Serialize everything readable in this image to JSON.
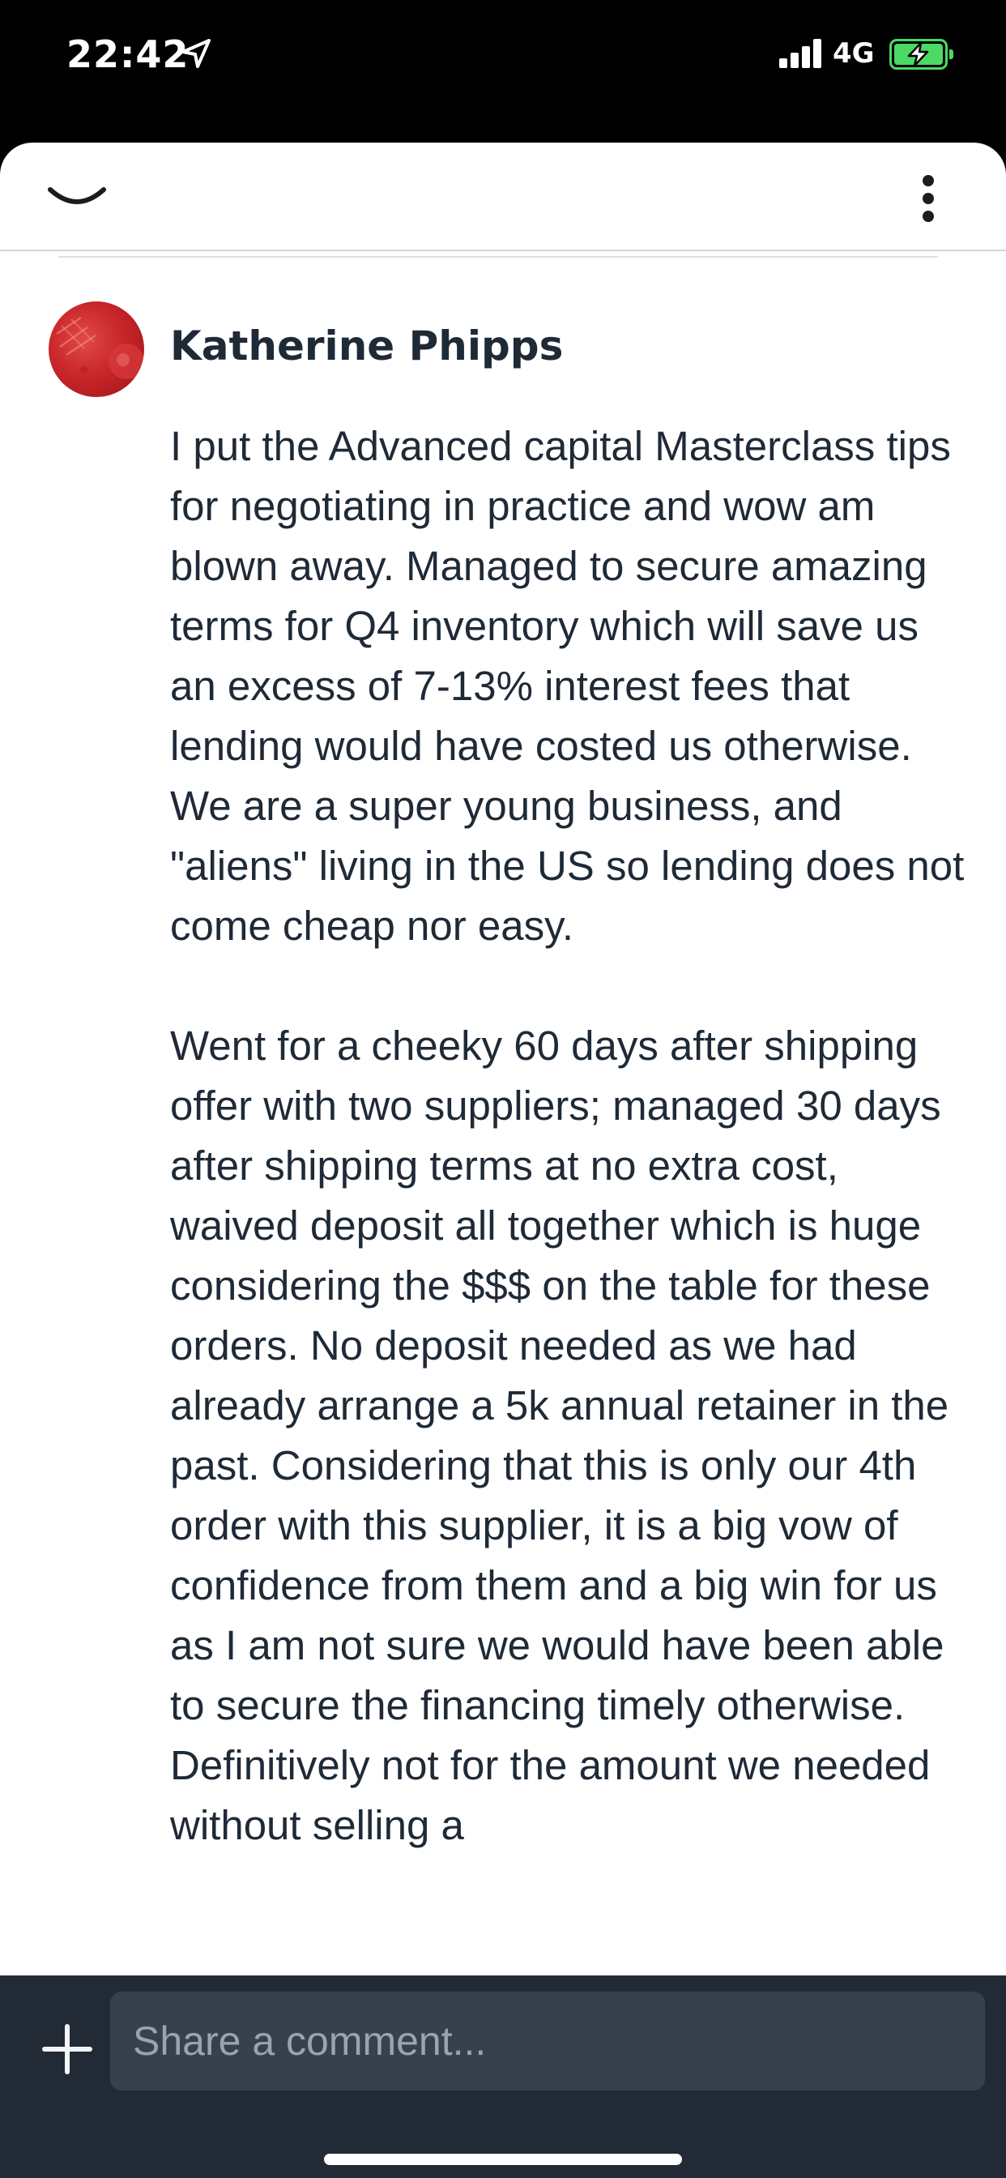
{
  "status_bar": {
    "time": "22:42",
    "network": "4G",
    "icons": [
      "location-arrow-icon",
      "signal-bars-icon",
      "battery-charging-icon"
    ],
    "battery_color": "#4cd964"
  },
  "header": {
    "icons": [
      "chevron-down-icon",
      "more-vertical-icon"
    ]
  },
  "comment": {
    "author": "Katherine Phipps",
    "paragraphs": [
      "I put the Advanced capital Masterclass tips for negotiating in practice and wow am blown away. Managed to secure amazing terms for Q4 inventory which will save us an excess of 7-13% interest fees that lending would have costed us otherwise. We are a super young business, and \"aliens\" living in the US so lending does not come cheap nor easy.",
      "Went for a cheeky 60 days after shipping offer with two suppliers; managed 30 days after shipping terms at no extra cost, waived deposit all together which is huge considering the $$$ on the table for these orders. No deposit needed as we had already arrange a 5k annual retainer in the past. Considering that this is only our 4th order with this supplier, it is a big vow of confidence from them and a big win for us as I am not sure we would have been able to secure the financing timely otherwise. Definitively not for the amount we needed without selling a"
    ]
  },
  "composer": {
    "placeholder": "Share a comment...",
    "value": ""
  },
  "colors": {
    "composer_bg": "#222a35",
    "input_bg": "#37404d",
    "text": "#1f2a37",
    "avatar": "#c9262a"
  }
}
